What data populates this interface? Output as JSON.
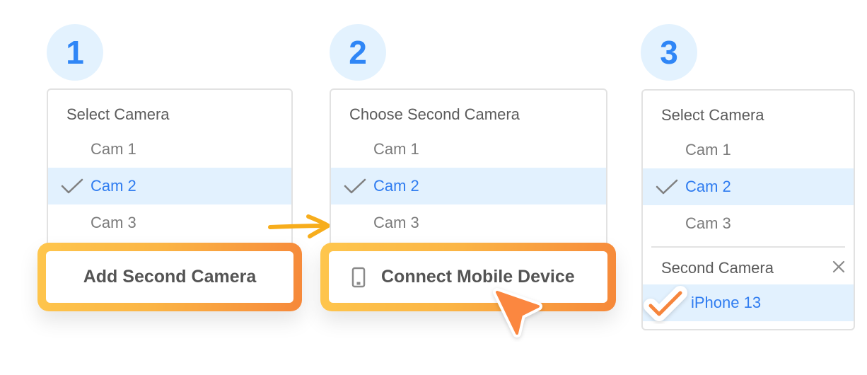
{
  "steps": [
    {
      "number": "1",
      "card": {
        "title": "Select Camera",
        "options": [
          {
            "label": "Cam 1",
            "selected": false
          },
          {
            "label": "Cam 2",
            "selected": true
          },
          {
            "label": "Cam 3",
            "selected": false
          }
        ]
      },
      "action": {
        "label": "Add Second Camera",
        "icon": null
      }
    },
    {
      "number": "2",
      "card": {
        "title": "Choose Second Camera",
        "options": [
          {
            "label": "Cam 1",
            "selected": false
          },
          {
            "label": "Cam 2",
            "selected": true
          },
          {
            "label": "Cam 3",
            "selected": false
          }
        ]
      },
      "action": {
        "label": "Connect Mobile Device",
        "icon": "mobile-phone-icon"
      }
    },
    {
      "number": "3",
      "card": {
        "title": "Select Camera",
        "options": [
          {
            "label": "Cam 1",
            "selected": false
          },
          {
            "label": "Cam 2",
            "selected": true
          },
          {
            "label": "Cam 3",
            "selected": false
          }
        ],
        "second_camera": {
          "title": "Second Camera",
          "close_icon": "close-icon",
          "device": {
            "label": "iPhone 13",
            "selected": true
          }
        }
      }
    }
  ],
  "icons": {
    "checkmark": "checkmark-icon",
    "arrow": "arrow-right-icon",
    "cursor": "pointer-cursor-icon"
  },
  "colors": {
    "accent_blue": "#2f7cf0",
    "badge_bg": "#e3f2fe",
    "selected_row_bg": "#e2f1fe",
    "orange": "#f6883a",
    "yellow": "#fec64d",
    "arrow": "#f7ad1c",
    "text_gray": "#5b5b5b"
  }
}
